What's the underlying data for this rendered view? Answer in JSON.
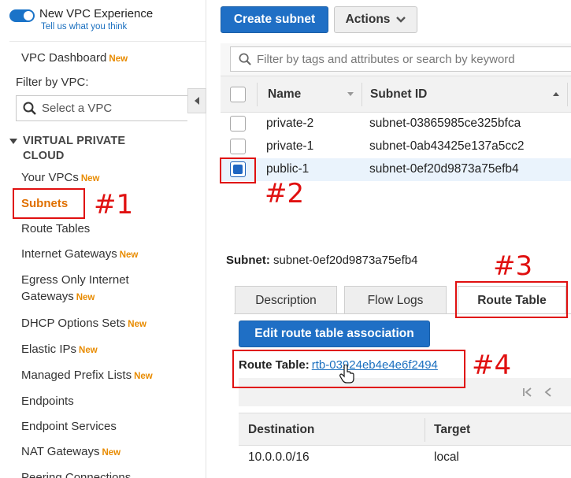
{
  "sidebar": {
    "toggle_title": "New VPC Experience",
    "toggle_link": "Tell us what you think",
    "dashboard": {
      "label": "VPC Dashboard",
      "badge": "New"
    },
    "filter_label": "Filter by VPC:",
    "select_placeholder": "Select a VPC",
    "section": "VIRTUAL PRIVATE CLOUD",
    "items": [
      {
        "label": "Your VPCs",
        "badge": "New"
      },
      {
        "label": "Subnets",
        "badge": ""
      },
      {
        "label": "Route Tables",
        "badge": ""
      },
      {
        "label": "Internet Gateways",
        "badge": "New"
      },
      {
        "label": "Egress Only Internet",
        "label2": "Gateways",
        "badge": "New"
      },
      {
        "label": "DHCP Options Sets",
        "badge": "New"
      },
      {
        "label": "Elastic IPs",
        "badge": "New"
      },
      {
        "label": "Managed Prefix Lists",
        "badge": "New"
      },
      {
        "label": "Endpoints",
        "badge": ""
      },
      {
        "label": "Endpoint Services",
        "badge": ""
      },
      {
        "label": "NAT Gateways",
        "badge": "New"
      },
      {
        "label": "Peering Connections",
        "badge": ""
      }
    ]
  },
  "toolbar": {
    "create_label": "Create subnet",
    "actions_label": "Actions"
  },
  "search": {
    "placeholder": "Filter by tags and attributes or search by keyword"
  },
  "table": {
    "headers": [
      "Name",
      "Subnet ID"
    ],
    "rows": [
      {
        "name": "private-2",
        "id": "subnet-03865985ce325bfca",
        "checked": false
      },
      {
        "name": "private-1",
        "id": "subnet-0ab43425e137a5cc2",
        "checked": false
      },
      {
        "name": "public-1",
        "id": "subnet-0ef20d9873a75efb4",
        "checked": true
      }
    ]
  },
  "detail": {
    "label": "Subnet:",
    "value": "subnet-0ef20d9873a75efb4",
    "tabs": [
      "Description",
      "Flow Logs",
      "Route Table"
    ],
    "edit_button": "Edit route table association",
    "route_table_label": "Route Table:",
    "route_table_value": "rtb-03924eb4e4e6f2494",
    "grid_headers": [
      "Destination",
      "Target"
    ],
    "grid_rows": [
      {
        "destination": "10.0.0.0/16",
        "target": "local"
      }
    ]
  },
  "annotations": [
    "#1",
    "#2",
    "#3",
    "#4"
  ],
  "colors": {
    "accent": "#1f6fc5",
    "new_badge": "#e88b00",
    "annotation": "#e01010",
    "active_nav": "#e07000"
  }
}
